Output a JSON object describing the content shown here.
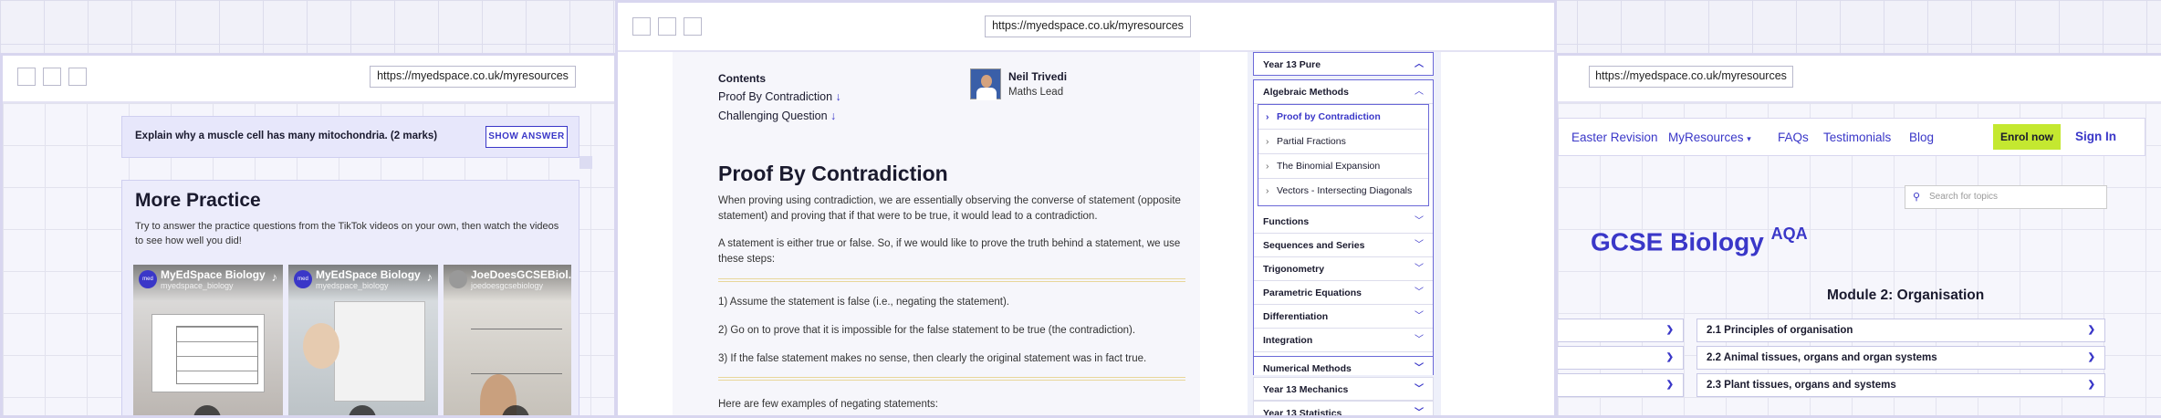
{
  "colors": {
    "accent": "#3a37c8",
    "enrol": "#c4e830",
    "window_border": "#d8d6ef"
  },
  "left_window": {
    "url": "https://myedspace.co.uk/myresources",
    "question": "Explain why a muscle cell has many mitochondria. (2 marks)",
    "show_answer": "SHOW ANSWER",
    "more_practice": {
      "title": "More Practice",
      "description": "Try to answer the practice questions from the TikTok videos on your own, then watch the videos to see how well you did!",
      "videos": [
        {
          "name": "MyEdSpace Biology",
          "user": "myedspace_biology"
        },
        {
          "name": "MyEdSpace Biology",
          "user": "myedspace_biology"
        },
        {
          "name": "JoeDoesGCSEBiol...",
          "user": "joedoesgcsebiology"
        }
      ]
    }
  },
  "middle_window": {
    "url": "https://myedspace.co.uk/myresources",
    "contents_title": "Contents",
    "contents": [
      "Proof By Contradiction",
      "Challenging Question"
    ],
    "author": {
      "name": "Neil Trivedi",
      "role": "Maths Lead"
    },
    "heading": "Proof By Contradiction",
    "para1": "When proving using contradiction, we are essentially observing the converse of statement (opposite statement) and proving that if that were to be true, it would lead to a contradiction.",
    "para2": "A statement is either true or false. So, if we would like to prove the truth behind a statement, we use these steps:",
    "steps": [
      "1) Assume the statement is false (i.e., negating the statement).",
      "2) Go on to prove that it is impossible for the false statement to be true (the contradiction).",
      "3) If the false statement makes no sense, then clearly the original statement was in fact true."
    ],
    "para3": "Here are few examples of negating statements:",
    "sidebar": {
      "year13_pure": "Year 13 Pure",
      "algebraic_methods": "Algebraic Methods",
      "algebraic_items": [
        "Proof by Contradiction",
        "Partial Fractions",
        "The Binomial Expansion",
        "Vectors - Intersecting Diagonals"
      ],
      "topics": [
        "Functions",
        "Sequences and Series",
        "Trigonometry",
        "Parametric Equations",
        "Differentiation",
        "Integration",
        "Numerical Methods"
      ],
      "year13_mechanics": "Year 13 Mechanics",
      "year13_statistics": "Year 13 Statistics"
    }
  },
  "right_window": {
    "url": "https://myedspace.co.uk/myresources",
    "nav": {
      "links": [
        "Easter Revision",
        "MyResources",
        "FAQs",
        "Testimonials",
        "Blog"
      ],
      "enrol": "Enrol now",
      "signin": "Sign In"
    },
    "search_placeholder": "Search for topics",
    "title": "GCSE Biology",
    "title_sup": "AQA",
    "module": "Module 2: Organisation",
    "topics": [
      "2.1 Principles of organisation",
      "2.2 Animal tissues, organs and organ systems",
      "2.3 Plant tissues, organs and systems"
    ]
  }
}
